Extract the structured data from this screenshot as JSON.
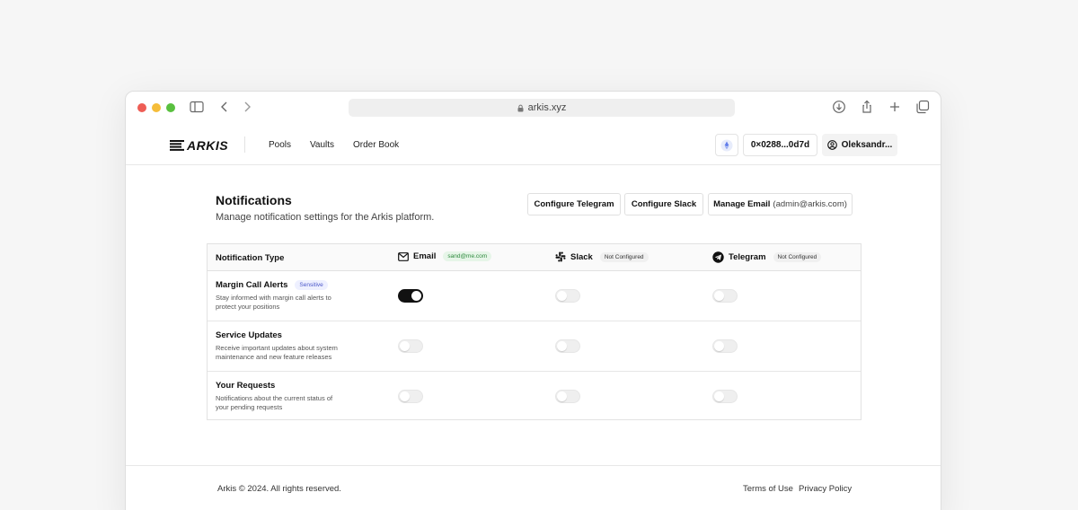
{
  "browser": {
    "url": "arkis.xyz"
  },
  "nav": {
    "logo_text": "ARKIS",
    "links": [
      "Pools",
      "Vaults",
      "Order Book"
    ],
    "wallet": "0×0288...0d7d",
    "user": "Oleksandr..."
  },
  "page": {
    "title": "Notifications",
    "subtitle": "Manage notification settings for the Arkis platform.",
    "buttons": {
      "telegram": "Configure Telegram",
      "slack": "Configure Slack",
      "email_label": "Manage Email",
      "email_value": "(admin@arkis.com)"
    }
  },
  "table": {
    "header_label": "Notification Type",
    "columns": [
      {
        "name": "Email",
        "badge": "sand@me.com",
        "icon": "mail-icon"
      },
      {
        "name": "Slack",
        "badge": "Not Configured",
        "icon": "slack-icon"
      },
      {
        "name": "Telegram",
        "badge": "Not Configured",
        "icon": "telegram-icon"
      }
    ],
    "rows": [
      {
        "title": "Margin Call Alerts",
        "badge": "Sensitive",
        "description": "Stay informed with margin call alerts to protect your positions",
        "toggles": [
          true,
          false,
          false
        ]
      },
      {
        "title": "Service Updates",
        "description": "Receive important updates about system maintenance and new feature releases",
        "toggles": [
          false,
          false,
          false
        ]
      },
      {
        "title": "Your Requests",
        "description": "Notifications about the current status of your pending requests",
        "toggles": [
          false,
          false,
          false
        ]
      }
    ]
  },
  "footer": {
    "copyright": "Arkis © 2024. All rights reserved.",
    "terms": "Terms of Use",
    "privacy": "Privacy Policy"
  },
  "colors": {
    "accent": "#111111",
    "email_badge_bg": "#e6f5e8",
    "sensitive_badge_bg": "#eef0ff"
  }
}
